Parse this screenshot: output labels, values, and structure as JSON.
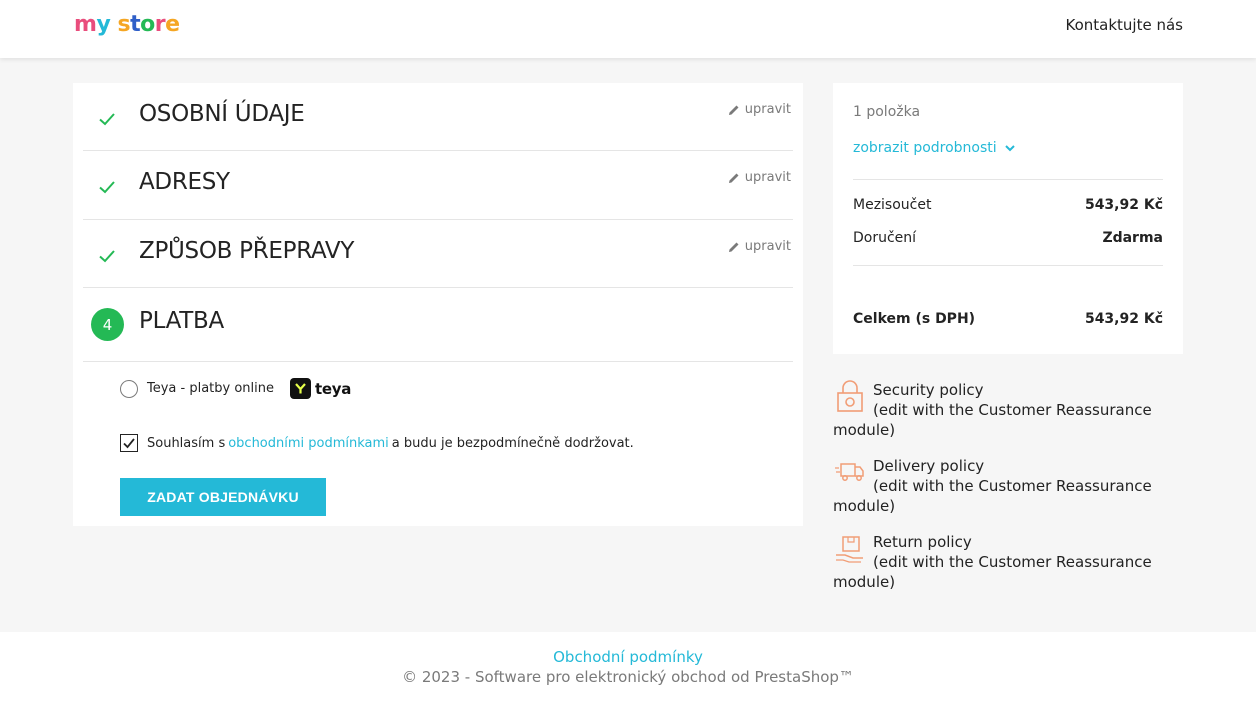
{
  "header": {
    "logo_parts": [
      {
        "text": "m",
        "color": "#e94d7c"
      },
      {
        "text": "y",
        "color": "#24b9d7"
      },
      {
        "text": " ",
        "color": "#000000"
      },
      {
        "text": "s",
        "color": "#f5a623"
      },
      {
        "text": "t",
        "color": "#2f5fc8"
      },
      {
        "text": "o",
        "color": "#24b955"
      },
      {
        "text": "r",
        "color": "#e94d7c"
      },
      {
        "text": "e",
        "color": "#f5a623"
      }
    ],
    "contact_label": "Kontaktujte nás"
  },
  "steps": [
    {
      "title": "OSOBNÍ ÚDAJE",
      "edit_label": "upravit",
      "status": "done"
    },
    {
      "title": "ADRESY",
      "edit_label": "upravit",
      "status": "done"
    },
    {
      "title": "ZPŮSOB PŘEPRAVY",
      "edit_label": "upravit",
      "status": "done"
    },
    {
      "title": "PLATBA",
      "number": "4",
      "status": "current"
    }
  ],
  "payment": {
    "option_label": "Teya - platby online",
    "provider_logo_text": "teya",
    "terms_prefix": "Souhlasím s",
    "terms_link": "obchodními podmínkami",
    "terms_suffix": "a budu je bezpodmínečně dodržovat.",
    "terms_checked": true,
    "order_button": "ZADAT OBJEDNÁVKU"
  },
  "summary": {
    "item_count": "1 položka",
    "details_label": "zobrazit podrobnosti",
    "subtotal_label": "Mezisoučet",
    "subtotal_value": "543,92 Kč",
    "shipping_label": "Doručení",
    "shipping_value": "Zdarma",
    "total_label": "Celkem (s DPH)",
    "total_value": "543,92 Kč"
  },
  "reassurance": [
    {
      "title": "Security policy",
      "desc": "(edit with the Customer Reassurance module)",
      "icon": "lock-icon"
    },
    {
      "title": "Delivery policy",
      "desc": "(edit with the Customer Reassurance module)",
      "icon": "truck-icon"
    },
    {
      "title": "Return policy",
      "desc": "(edit with the Customer Reassurance module)",
      "icon": "return-box-icon"
    }
  ],
  "footer": {
    "link": "Obchodní podmínky",
    "copyright": "© 2023 - Software pro elektronický obchod od PrestaShop™"
  },
  "colors": {
    "accent": "#24b9d7",
    "success": "#24b955",
    "reassurance_icon": "#f19d76"
  }
}
